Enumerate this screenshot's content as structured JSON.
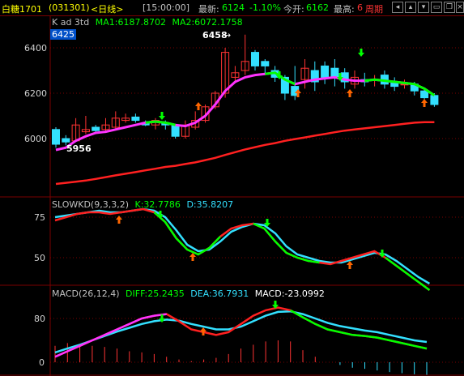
{
  "header": {
    "name": "白糖1701",
    "code": "(031301)",
    "period": "<日线>",
    "time": "[15:00:00]",
    "last_label": "最新:",
    "last_value": "6124",
    "change": "-1.10%",
    "open_label": "今开:",
    "open_value": "6162",
    "high_label": "最高:",
    "high_value": "6",
    "cycle_label": "周期"
  },
  "main_panel": {
    "title": "K ad 3td",
    "ma1_label": "MA1:6187.8702",
    "ma2_label": "MA2:6072.1758",
    "cursor_value": "6425",
    "high_marker": "6458",
    "low_marker": "5956",
    "y_ticks": [
      "6400",
      "6200",
      "6000"
    ]
  },
  "kd_panel": {
    "title": "SLOWKD(9,3,3,2)",
    "k_label": "K:32.7786",
    "d_label": "D:35.8207",
    "y_ticks": [
      "75",
      "50"
    ]
  },
  "macd_panel": {
    "title": "MACD(26,12,4)",
    "diff_label": "DIFF:25.2435",
    "dea_label": "DEA:36.7931",
    "macd_label": "MACD:-23.0992",
    "y_ticks": [
      "80",
      "0"
    ]
  },
  "colors": {
    "up": "#ff3333",
    "down": "#33e0ff",
    "ma1": "#ff33ff",
    "ma2": "#ff2020",
    "green": "#00ff00",
    "grid": "#7a0000",
    "yellow": "#ffff00"
  },
  "chart_data": {
    "type": "candlestick",
    "ma1_value": 6187.8702,
    "ma2_value": 6072.1758,
    "price_range": [
      5800,
      6600
    ],
    "candles": [
      {
        "o": 6040,
        "c": 5975,
        "h": 6050,
        "l": 5960
      },
      {
        "o": 6000,
        "c": 5985,
        "h": 6015,
        "l": 5970
      },
      {
        "o": 5990,
        "c": 6060,
        "h": 6090,
        "l": 5985
      },
      {
        "o": 6030,
        "c": 6040,
        "h": 6100,
        "l": 6020
      },
      {
        "o": 6050,
        "c": 6035,
        "h": 6060,
        "l": 6025
      },
      {
        "o": 6040,
        "c": 6060,
        "h": 6090,
        "l": 6030
      },
      {
        "o": 6050,
        "c": 6090,
        "h": 6120,
        "l": 6040
      },
      {
        "o": 6080,
        "c": 6090,
        "h": 6110,
        "l": 6070
      },
      {
        "o": 6095,
        "c": 6080,
        "h": 6110,
        "l": 6070
      },
      {
        "o": 6070,
        "c": 6060,
        "h": 6080,
        "l": 6055
      },
      {
        "o": 6060,
        "c": 6080,
        "h": 6090,
        "l": 6040
      },
      {
        "o": 6070,
        "c": 6060,
        "h": 6080,
        "l": 6040
      },
      {
        "o": 6060,
        "c": 6010,
        "h": 6065,
        "l": 6000
      },
      {
        "o": 6010,
        "c": 6060,
        "h": 6080,
        "l": 6000
      },
      {
        "o": 6050,
        "c": 6080,
        "h": 6120,
        "l": 6040
      },
      {
        "o": 6080,
        "c": 6140,
        "h": 6150,
        "l": 6070
      },
      {
        "o": 6140,
        "c": 6200,
        "h": 6210,
        "l": 6130
      },
      {
        "o": 6200,
        "c": 6380,
        "h": 6400,
        "l": 6180
      },
      {
        "o": 6270,
        "c": 6290,
        "h": 6320,
        "l": 6250
      },
      {
        "o": 6300,
        "c": 6340,
        "h": 6458,
        "l": 6280
      },
      {
        "o": 6380,
        "c": 6320,
        "h": 6390,
        "l": 6300
      },
      {
        "o": 6340,
        "c": 6320,
        "h": 6350,
        "l": 6280
      },
      {
        "o": 6300,
        "c": 6270,
        "h": 6320,
        "l": 6250
      },
      {
        "o": 6270,
        "c": 6200,
        "h": 6280,
        "l": 6170
      },
      {
        "o": 6230,
        "c": 6190,
        "h": 6320,
        "l": 6170
      },
      {
        "o": 6260,
        "c": 6310,
        "h": 6350,
        "l": 6220
      },
      {
        "o": 6300,
        "c": 6250,
        "h": 6340,
        "l": 6210
      },
      {
        "o": 6320,
        "c": 6270,
        "h": 6340,
        "l": 6240
      },
      {
        "o": 6310,
        "c": 6270,
        "h": 6350,
        "l": 6230
      },
      {
        "o": 6290,
        "c": 6250,
        "h": 6310,
        "l": 6220
      },
      {
        "o": 6240,
        "c": 6270,
        "h": 6300,
        "l": 6220
      },
      {
        "o": 6260,
        "c": 6250,
        "h": 6290,
        "l": 6230
      },
      {
        "o": 6260,
        "c": 6260,
        "h": 6280,
        "l": 6230
      },
      {
        "o": 6280,
        "c": 6240,
        "h": 6300,
        "l": 6220
      },
      {
        "o": 6250,
        "c": 6230,
        "h": 6270,
        "l": 6210
      },
      {
        "o": 6240,
        "c": 6240,
        "h": 6260,
        "l": 6220
      },
      {
        "o": 6240,
        "c": 6210,
        "h": 6250,
        "l": 6190
      },
      {
        "o": 6210,
        "c": 6180,
        "h": 6220,
        "l": 6170
      },
      {
        "o": 6190,
        "c": 6150,
        "h": 6200,
        "l": 6140
      }
    ],
    "ma1_series": [
      5950,
      5960,
      5990,
      6010,
      6025,
      6030,
      6040,
      6050,
      6060,
      6070,
      6075,
      6070,
      6060,
      6055,
      6070,
      6100,
      6150,
      6210,
      6250,
      6270,
      6280,
      6285,
      6290,
      6260,
      6240,
      6250,
      6260,
      6265,
      6270,
      6260,
      6255,
      6255,
      6260,
      6255,
      6250,
      6245,
      6240,
      6220,
      6190
    ],
    "ma2_series": [
      5800,
      5805,
      5810,
      5815,
      5822,
      5830,
      5838,
      5845,
      5852,
      5860,
      5867,
      5875,
      5880,
      5888,
      5895,
      5905,
      5915,
      5928,
      5940,
      5952,
      5962,
      5972,
      5980,
      5990,
      5998,
      6005,
      6013,
      6020,
      6028,
      6035,
      6040,
      6045,
      6050,
      6055,
      6060,
      6065,
      6070,
      6072,
      6072
    ],
    "kd_k": [
      73,
      75,
      77,
      78,
      78,
      77,
      78,
      79,
      80,
      78,
      72,
      62,
      55,
      52,
      56,
      63,
      68,
      70,
      71,
      68,
      60,
      53,
      50,
      48,
      47,
      46,
      48,
      50,
      52,
      54,
      50,
      45,
      40,
      35,
      30
    ],
    "kd_d": [
      75,
      76,
      77,
      78,
      79,
      78,
      78,
      79,
      80,
      79,
      75,
      67,
      58,
      54,
      55,
      60,
      66,
      69,
      71,
      70,
      65,
      57,
      52,
      50,
      48,
      47,
      47,
      49,
      51,
      53,
      52,
      48,
      43,
      38,
      34
    ],
    "macd_diff": [
      10,
      20,
      30,
      40,
      50,
      60,
      70,
      80,
      85,
      88,
      75,
      60,
      55,
      50,
      55,
      70,
      85,
      95,
      100,
      95,
      82,
      70,
      60,
      55,
      50,
      48,
      45,
      40,
      35,
      30,
      25
    ],
    "macd_dea": [
      18,
      25,
      32,
      40,
      48,
      56,
      63,
      70,
      75,
      78,
      76,
      70,
      65,
      60,
      60,
      65,
      75,
      85,
      92,
      93,
      88,
      80,
      72,
      66,
      62,
      58,
      55,
      50,
      45,
      40,
      37
    ],
    "macd_hist": [
      30,
      35,
      32,
      30,
      28,
      25,
      20,
      18,
      15,
      10,
      5,
      2,
      5,
      8,
      15,
      25,
      32,
      38,
      40,
      38,
      22,
      10,
      0,
      -5,
      -10,
      -12,
      -15,
      -18,
      -20,
      -22,
      -23
    ]
  }
}
